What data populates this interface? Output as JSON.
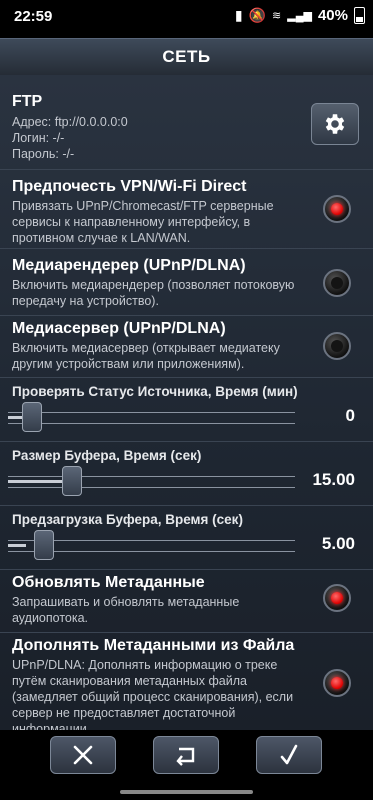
{
  "status": {
    "time": "22:59",
    "battery": "40%"
  },
  "title": "СЕТЬ",
  "ftp": {
    "title": "FTP",
    "address": "Адрес: ftp://0.0.0.0:0",
    "login": "Логин: -/-",
    "password": "Пароль: -/-"
  },
  "vpn": {
    "title": "Предпочесть VPN/Wi-Fi Direct",
    "desc": "Привязать UPnP/Chromecast/FTP серверные сервисы к направленному интерфейсу, в противном случае к LAN/WAN.",
    "enabled": true
  },
  "renderer": {
    "title": "Медиарендерер (UPnP/DLNA)",
    "desc": "Включить медиарендерер (позволяет потоковую передачу на устройство).",
    "enabled": false
  },
  "server": {
    "title": "Медиасервер (UPnP/DLNA)",
    "desc": "Включить медиасервер (открывает медиатеку другим устройствам или приложениям).",
    "enabled": false
  },
  "check_source": {
    "label": "Проверять Статус Источника, Время (мин)",
    "value": "0"
  },
  "buffer_size": {
    "label": "Размер Буфера, Время (сек)",
    "value": "15.00"
  },
  "preload": {
    "label": "Предзагрузка Буфера, Время (сек)",
    "value": "5.00"
  },
  "metadata": {
    "title": "Обновлять Метаданные",
    "desc": "Запрашивать и обновлять метаданные аудиопотока.",
    "enabled": true
  },
  "metadata_file": {
    "title": "Дополнять Метаданными из Файла",
    "desc": "UPnP/DLNA: Дополнять информацию о треке путём сканирования метаданных файла (замедляет общий процесс сканирования), если сервер не предоставляет достаточной информации.",
    "enabled": true
  },
  "colors": {
    "accent_red": "#e00000",
    "panel": "#232b36"
  },
  "icons": {
    "cancel": "close-icon",
    "undo": "undo-icon",
    "ok": "checkmark-icon",
    "settings": "gear-icon"
  }
}
